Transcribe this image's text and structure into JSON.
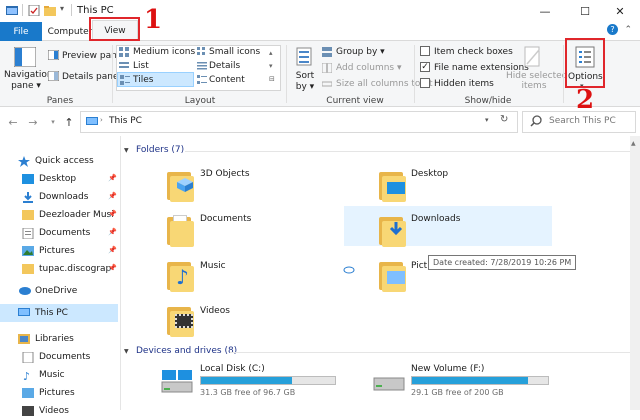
{
  "window": {
    "title": "This PC"
  },
  "controls": {
    "minimize": "—",
    "maximize": "☐",
    "close": "✕"
  },
  "tabs": {
    "file": "File",
    "computer": "Computer",
    "view": "View"
  },
  "annotations": {
    "step1": "1",
    "step2": "2"
  },
  "ribbon": {
    "navigation_pane": "Navigation\npane ▾",
    "preview_pane": "Preview pane",
    "details_pane": "Details pane",
    "panes_group": "Panes",
    "layout": {
      "medium_icons": "Medium icons",
      "small_icons": "Small icons",
      "list": "List",
      "details": "Details",
      "tiles": "Tiles",
      "content": "Content",
      "group": "Layout"
    },
    "current_view": {
      "sort_by": "Sort\nby ▾",
      "group_by": "Group by ▾",
      "add_columns": "Add columns ▾",
      "size_columns": "Size all columns to fit",
      "group": "Current view"
    },
    "show_hide": {
      "item_check_boxes": "Item check boxes",
      "file_name_extensions": "File name extensions",
      "hidden_items": "Hidden items",
      "hide_selected": "Hide selected\nitems",
      "group": "Show/hide"
    },
    "options": "Options"
  },
  "address": {
    "path": "This PC",
    "search_placeholder": "Search This PC"
  },
  "sidebar": {
    "items": [
      {
        "label": "Quick access"
      },
      {
        "label": "Desktop"
      },
      {
        "label": "Downloads"
      },
      {
        "label": "Deezloader Musi"
      },
      {
        "label": "Documents"
      },
      {
        "label": "Pictures"
      },
      {
        "label": "tupac.discograp"
      },
      {
        "label": "OneDrive"
      },
      {
        "label": "This PC"
      },
      {
        "label": "Libraries"
      },
      {
        "label": "Documents"
      },
      {
        "label": "Music"
      },
      {
        "label": "Pictures"
      },
      {
        "label": "Videos"
      }
    ]
  },
  "content": {
    "folders_header": "Folders (7)",
    "folders": [
      {
        "name": "3D Objects"
      },
      {
        "name": "Desktop"
      },
      {
        "name": "Documents"
      },
      {
        "name": "Downloads"
      },
      {
        "name": "Music"
      },
      {
        "name": "Pictures"
      },
      {
        "name": "Videos"
      }
    ],
    "tooltip": "Date created: 7/28/2019 10:26 PM",
    "drives_header": "Devices and drives (8)",
    "drives": [
      {
        "name": "Local Disk (C:)",
        "free": "31.3 GB free of 96.7 GB",
        "used_fraction": 0.68
      },
      {
        "name": "New Volume (F:)",
        "free": "29.1 GB free of 200 GB",
        "used_fraction": 0.85
      }
    ]
  },
  "colors": {
    "accent": "#1979ca",
    "highlight": "#e0262b",
    "selection": "#cce8ff",
    "bar": "#26a0da"
  }
}
